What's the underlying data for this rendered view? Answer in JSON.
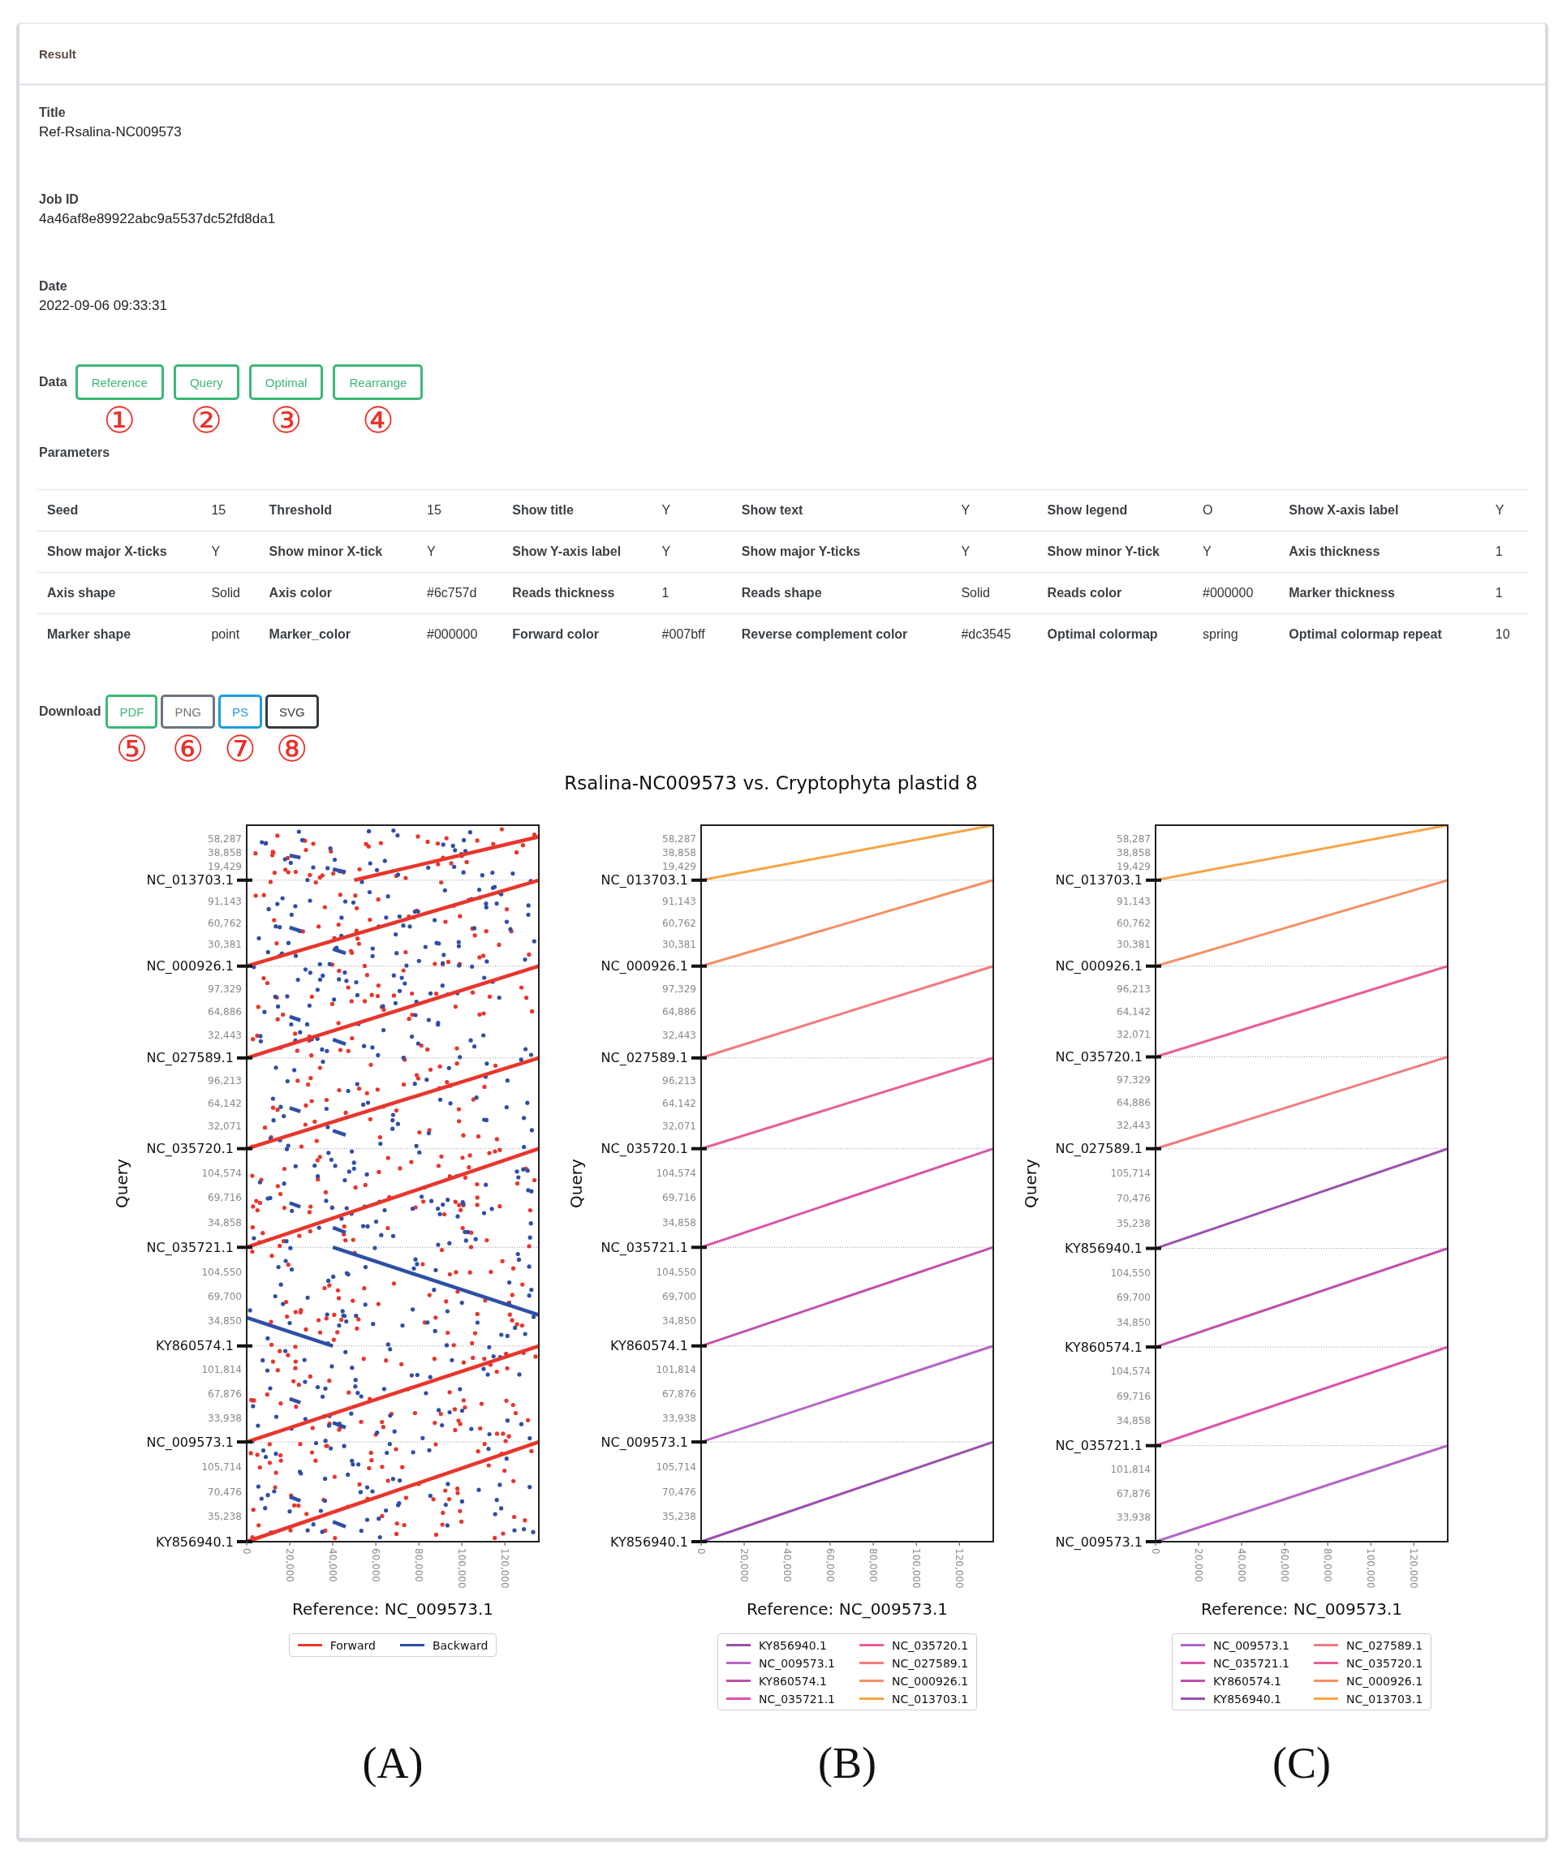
{
  "card": {
    "header": "Result"
  },
  "fields": [
    {
      "label": "Title",
      "value": "Ref-Rsalina-NC009573"
    },
    {
      "label": "Job ID",
      "value": "4a46af8e89922abc9a5537dc52fd8da1"
    },
    {
      "label": "Date",
      "value": "2022-09-06 09:33:31"
    }
  ],
  "data": {
    "label": "Data",
    "buttons": [
      {
        "label": "Reference",
        "annotation": "①"
      },
      {
        "label": "Query",
        "annotation": "②"
      },
      {
        "label": "Optimal",
        "annotation": "③"
      },
      {
        "label": "Rearrange",
        "annotation": "④"
      }
    ]
  },
  "parameters": {
    "label": "Parameters",
    "rows": [
      [
        {
          "name": "Seed",
          "value": "15"
        },
        {
          "name": "Threshold",
          "value": "15"
        },
        {
          "name": "Show title",
          "value": "Y"
        },
        {
          "name": "Show text",
          "value": "Y"
        },
        {
          "name": "Show legend",
          "value": "O"
        },
        {
          "name": "Show X-axis label",
          "value": "Y"
        }
      ],
      [
        {
          "name": "Show major X-ticks",
          "value": "Y"
        },
        {
          "name": "Show minor X-tick",
          "value": "Y"
        },
        {
          "name": "Show Y-axis label",
          "value": "Y"
        },
        {
          "name": "Show major Y-ticks",
          "value": "Y"
        },
        {
          "name": "Show minor Y-tick",
          "value": "Y"
        },
        {
          "name": "Axis thickness",
          "value": "1"
        }
      ],
      [
        {
          "name": "Axis shape",
          "value": "Solid"
        },
        {
          "name": "Axis color",
          "value": "#6c757d"
        },
        {
          "name": "Reads thickness",
          "value": "1"
        },
        {
          "name": "Reads shape",
          "value": "Solid"
        },
        {
          "name": "Reads color",
          "value": "#000000"
        },
        {
          "name": "Marker thickness",
          "value": "1"
        }
      ],
      [
        {
          "name": "Marker shape",
          "value": "point"
        },
        {
          "name": "Marker_color",
          "value": "#000000"
        },
        {
          "name": "Forward color",
          "value": "#007bff"
        },
        {
          "name": "Reverse complement color",
          "value": "#dc3545"
        },
        {
          "name": "Optimal colormap",
          "value": "spring"
        },
        {
          "name": "Optimal colormap repeat",
          "value": "10"
        }
      ]
    ]
  },
  "download": {
    "label": "Download",
    "buttons": [
      {
        "label": "PDF",
        "color": "#3cb878",
        "annotation": "⑤"
      },
      {
        "label": "PNG",
        "color": "#6c757d",
        "annotation": "⑥"
      },
      {
        "label": "PS",
        "color": "#1e9be0",
        "annotation": "⑦"
      },
      {
        "label": "SVG",
        "color": "#343a40",
        "annotation": "⑧"
      }
    ]
  },
  "figure": {
    "title": "Rsalina-NC009573 vs. Cryptophyta plastid 8",
    "panels": [
      {
        "kind": "dotplot",
        "caption": "(A)",
        "xlabel": "Reference: NC_009573.1",
        "ylabel": "Query",
        "xtick_labels": [
          "0",
          "20,000",
          "40,000",
          "60,000",
          "80,000",
          "100,000",
          "120,000"
        ],
        "bands": [
          {
            "label": "NC_013703.1",
            "tick_labels": [
              "58,287",
              "38,858",
              "19,429"
            ],
            "reversed": false
          },
          {
            "label": "NC_000926.1",
            "tick_labels": [
              "91,143",
              "60,762",
              "30,381"
            ],
            "reversed": false
          },
          {
            "label": "NC_027589.1",
            "tick_labels": [
              "97,329",
              "64,886",
              "32,443"
            ],
            "reversed": false
          },
          {
            "label": "NC_035720.1",
            "tick_labels": [
              "96,213",
              "64,142",
              "32,071"
            ],
            "reversed": false
          },
          {
            "label": "NC_035721.1",
            "tick_labels": [
              "104,574",
              "69,716",
              "34,858"
            ],
            "reversed": false
          },
          {
            "label": "KY860574.1",
            "tick_labels": [
              "104,550",
              "69,700",
              "34,850"
            ],
            "reversed": true
          },
          {
            "label": "NC_009573.1",
            "tick_labels": [
              "101,814",
              "67,876",
              "33,938"
            ],
            "reversed": false
          },
          {
            "label": "KY856940.1",
            "tick_labels": [
              "105,714",
              "70,476",
              "35,238"
            ],
            "reversed": false
          }
        ],
        "legend": [
          {
            "label": "Forward",
            "color": "#e8362c"
          },
          {
            "label": "Backward",
            "color": "#2f4fa6"
          }
        ]
      },
      {
        "kind": "lineplot",
        "caption": "(B)",
        "xlabel": "Reference: NC_009573.1",
        "ylabel": "Query",
        "xtick_labels": [
          "0",
          "20,000",
          "40,000",
          "60,000",
          "80,000",
          "100,000",
          "120,000"
        ],
        "bands": [
          {
            "label": "NC_013703.1",
            "tick_labels": [
              "58,287",
              "38,858",
              "19,429"
            ]
          },
          {
            "label": "NC_000926.1",
            "tick_labels": [
              "91,143",
              "60,762",
              "30,381"
            ]
          },
          {
            "label": "NC_027589.1",
            "tick_labels": [
              "97,329",
              "64,886",
              "32,443"
            ]
          },
          {
            "label": "NC_035720.1",
            "tick_labels": [
              "96,213",
              "64,142",
              "32,071"
            ]
          },
          {
            "label": "NC_035721.1",
            "tick_labels": [
              "104,574",
              "69,716",
              "34,858"
            ]
          },
          {
            "label": "KY860574.1",
            "tick_labels": [
              "104,550",
              "69,700",
              "34,850"
            ]
          },
          {
            "label": "NC_009573.1",
            "tick_labels": [
              "101,814",
              "67,876",
              "33,938"
            ]
          },
          {
            "label": "KY856940.1",
            "tick_labels": [
              "105,714",
              "70,476",
              "35,238"
            ]
          }
        ],
        "legend": [
          {
            "label": "KY856940.1",
            "color": "#9c50ad"
          },
          {
            "label": "NC_009573.1",
            "color": "#b565c4"
          },
          {
            "label": "KY860574.1",
            "color": "#c24fae"
          },
          {
            "label": "NC_035721.1",
            "color": "#dc52a8"
          },
          {
            "label": "NC_035720.1",
            "color": "#ea5e98"
          },
          {
            "label": "NC_027589.1",
            "color": "#f27a7c"
          },
          {
            "label": "NC_000926.1",
            "color": "#f68f64"
          },
          {
            "label": "NC_013703.1",
            "color": "#f7a445"
          }
        ]
      },
      {
        "kind": "lineplot",
        "caption": "(C)",
        "xlabel": "Reference: NC_009573.1",
        "ylabel": "Query",
        "xtick_labels": [
          "0",
          "20,000",
          "40,000",
          "60,000",
          "80,000",
          "100,000",
          "120,000"
        ],
        "bands": [
          {
            "label": "NC_013703.1",
            "tick_labels": [
              "58,287",
              "38,858",
              "19,429"
            ]
          },
          {
            "label": "NC_000926.1",
            "tick_labels": [
              "91,143",
              "60,762",
              "30,381"
            ]
          },
          {
            "label": "NC_035720.1",
            "tick_labels": [
              "96,213",
              "64,142",
              "32,071"
            ]
          },
          {
            "label": "NC_027589.1",
            "tick_labels": [
              "97,329",
              "64,886",
              "32,443"
            ]
          },
          {
            "label": "KY856940.1",
            "tick_labels": [
              "105,714",
              "70,476",
              "35,238"
            ]
          },
          {
            "label": "KY860574.1",
            "tick_labels": [
              "104,550",
              "69,700",
              "34,850"
            ]
          },
          {
            "label": "NC_035721.1",
            "tick_labels": [
              "104,574",
              "69,716",
              "34,858"
            ]
          },
          {
            "label": "NC_009573.1",
            "tick_labels": [
              "101,814",
              "67,876",
              "33,938"
            ]
          }
        ],
        "legend": [
          {
            "label": "NC_009573.1",
            "color": "#b565c4"
          },
          {
            "label": "NC_035721.1",
            "color": "#dc52a8"
          },
          {
            "label": "KY860574.1",
            "color": "#c24fae"
          },
          {
            "label": "KY856940.1",
            "color": "#9c50ad"
          },
          {
            "label": "NC_027589.1",
            "color": "#f27a7c"
          },
          {
            "label": "NC_035720.1",
            "color": "#ea5e98"
          },
          {
            "label": "NC_000926.1",
            "color": "#f68f64"
          },
          {
            "label": "NC_013703.1",
            "color": "#f7a445"
          }
        ]
      }
    ]
  }
}
